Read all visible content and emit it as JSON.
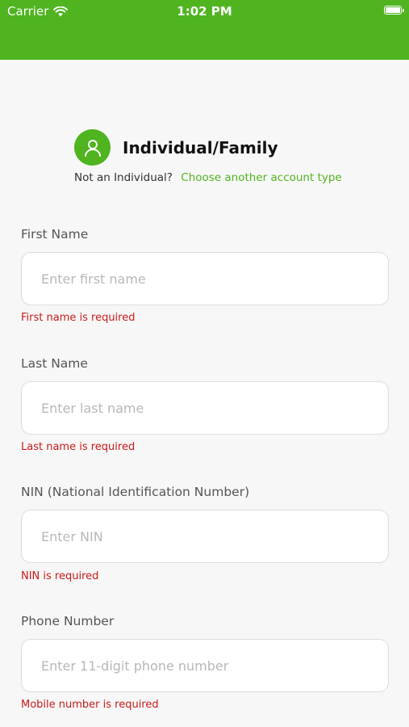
{
  "status_bar": {
    "carrier": "Carrier",
    "time": "1:02 PM"
  },
  "account": {
    "title": "Individual/Family",
    "prompt": "Not an Individual?",
    "link": "Choose another account type",
    "icon": "user-icon"
  },
  "colors": {
    "brand": "#4fb41f",
    "error": "#cc1a1a"
  },
  "form": {
    "first_name": {
      "label": "First Name",
      "placeholder": "Enter first name",
      "value": "",
      "error": "First name is required"
    },
    "last_name": {
      "label": "Last Name",
      "placeholder": "Enter last name",
      "value": "",
      "error": "Last name is required"
    },
    "nin": {
      "label": "NIN (National Identification Number)",
      "placeholder": "Enter NIN",
      "value": "",
      "error": "NIN is required"
    },
    "phone": {
      "label": "Phone Number",
      "placeholder": "Enter 11-digit phone number",
      "value": "",
      "error": "Mobile number is required"
    }
  }
}
